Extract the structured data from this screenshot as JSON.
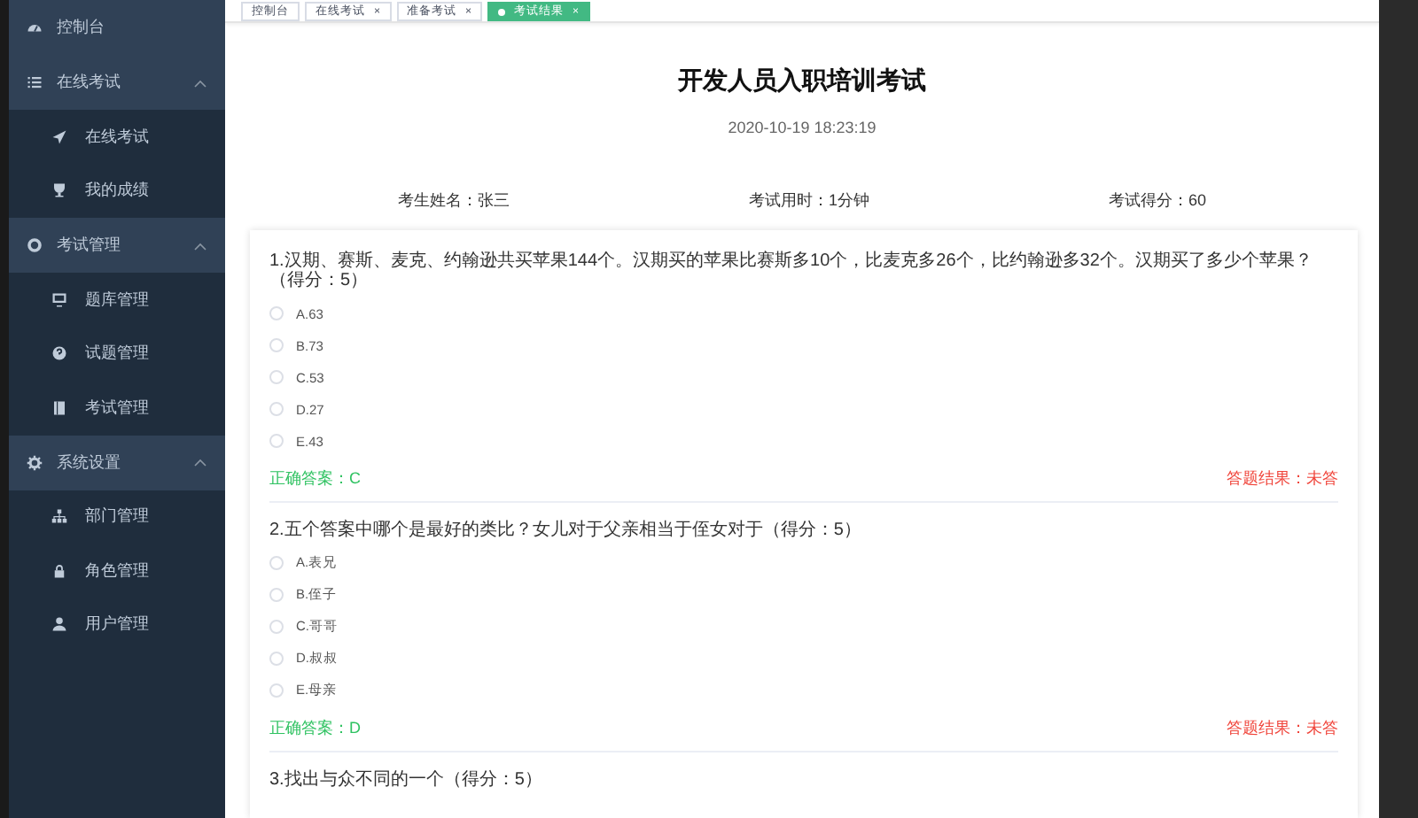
{
  "sidebar": {
    "items": [
      {
        "label": "控制台",
        "kind": "link"
      },
      {
        "label": "在线考试",
        "kind": "group",
        "expanded": true,
        "children": [
          {
            "label": "在线考试"
          },
          {
            "label": "我的成绩"
          }
        ]
      },
      {
        "label": "考试管理",
        "kind": "group",
        "expanded": true,
        "children": [
          {
            "label": "题库管理"
          },
          {
            "label": "试题管理"
          },
          {
            "label": "考试管理"
          }
        ]
      },
      {
        "label": "系统设置",
        "kind": "group",
        "expanded": true,
        "children": [
          {
            "label": "部门管理"
          },
          {
            "label": "角色管理"
          },
          {
            "label": "用户管理"
          }
        ]
      }
    ]
  },
  "tabs": [
    {
      "label": "控制台",
      "selected": false,
      "closable": false
    },
    {
      "label": "在线考试",
      "selected": false,
      "closable": true
    },
    {
      "label": "准备考试",
      "selected": false,
      "closable": true
    },
    {
      "label": "考试结果",
      "selected": true,
      "closable": true
    }
  ],
  "close_glyph": "×",
  "exam": {
    "title": "开发人员入职培训考试",
    "date": "2020-10-19 18:23:19",
    "info": [
      "考生姓名：张三",
      "考试用时：1分钟",
      "考试得分：60"
    ],
    "questions": [
      {
        "text": "1.汉期、赛斯、麦克、约翰逊共买苹果144个。汉期买的苹果比赛斯多10个，比麦克多26个，比约翰逊多32个。汉期买了多少个苹果？（得分：5）",
        "options": [
          {
            "label": "A.63",
            "selected": false
          },
          {
            "label": "B.73",
            "selected": false
          },
          {
            "label": "C.53",
            "selected": false
          },
          {
            "label": "D.27",
            "selected": false
          },
          {
            "label": "E.43",
            "selected": false
          }
        ],
        "correct": "正确答案：C",
        "result": "答题结果：未答"
      },
      {
        "text": "2.五个答案中哪个是最好的类比？女儿对于父亲相当于侄女对于（得分：5）",
        "options": [
          {
            "label": "A.表兄",
            "selected": false
          },
          {
            "label": "B.侄子",
            "selected": false
          },
          {
            "label": "C.哥哥",
            "selected": false
          },
          {
            "label": "D.叔叔",
            "selected": false
          },
          {
            "label": "E.母亲",
            "selected": false
          }
        ],
        "correct": "正确答案：D",
        "result": "答题结果：未答"
      },
      {
        "text": "3.找出与众不同的一个（得分：5）"
      }
    ]
  }
}
